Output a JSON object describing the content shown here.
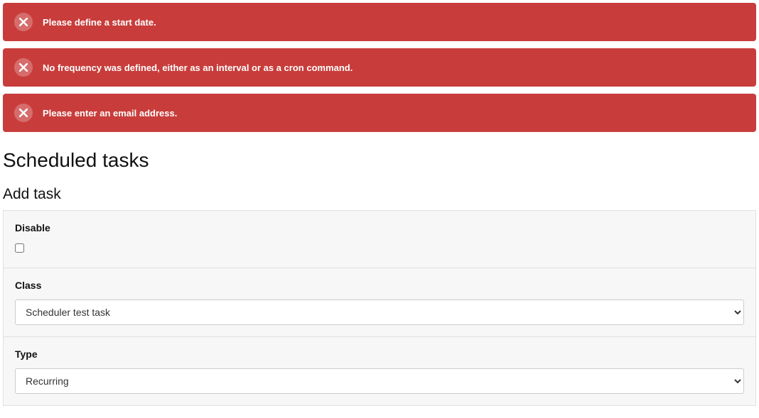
{
  "alerts": [
    {
      "message": "Please define a start date."
    },
    {
      "message": "No frequency was defined, either as an interval or as a cron command."
    },
    {
      "message": "Please enter an email address."
    }
  ],
  "page": {
    "title": "Scheduled tasks",
    "section_title": "Add task"
  },
  "form": {
    "disable": {
      "label": "Disable",
      "checked": false
    },
    "class": {
      "label": "Class",
      "value": "Scheduler test task"
    },
    "type": {
      "label": "Type",
      "value": "Recurring"
    }
  }
}
